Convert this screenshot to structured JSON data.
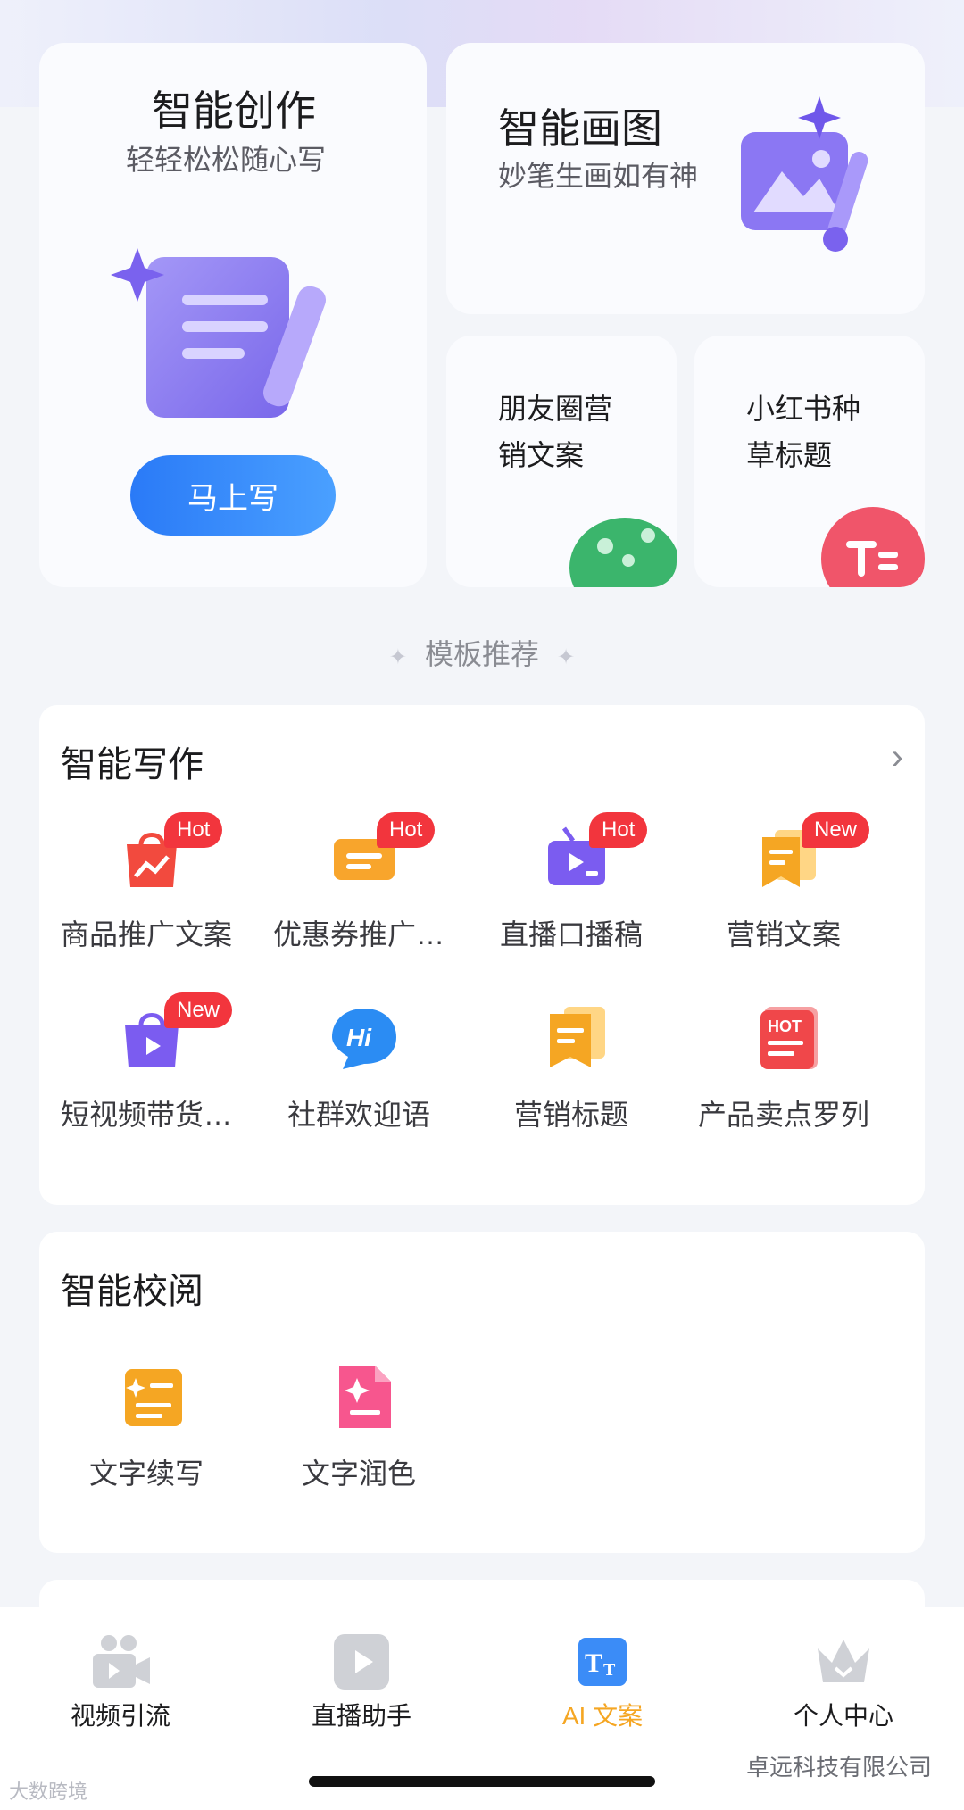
{
  "hero": {
    "create": {
      "title": "智能创作",
      "subtitle": "轻轻松松随心写",
      "button": "马上写"
    },
    "draw": {
      "title": "智能画图",
      "subtitle": "妙笔生画如有神"
    },
    "moments": {
      "line1": "朋友圈营",
      "line2": "销文案"
    },
    "xhs": {
      "line1": "小红书种",
      "line2": "草标题"
    }
  },
  "divider": {
    "label": "模板推荐"
  },
  "writing": {
    "title": "智能写作",
    "items": [
      {
        "label": "商品推广文案",
        "badge": "Hot",
        "icon": "shopping-bag-trend-icon",
        "color": "#f24a3e"
      },
      {
        "label": "优惠券推广…",
        "badge": "Hot",
        "icon": "coupon-icon",
        "color": "#f8a52c"
      },
      {
        "label": "直播口播稿",
        "badge": "Hot",
        "icon": "live-tv-icon",
        "color": "#7b5cf0"
      },
      {
        "label": "营销文案",
        "badge": "New",
        "icon": "bookmark-doc-icon",
        "color": "#f5a623"
      },
      {
        "label": "短视频带货…",
        "badge": "New",
        "icon": "video-bag-icon",
        "color": "#7b5cf0"
      },
      {
        "label": "社群欢迎语",
        "badge": "",
        "icon": "hi-chat-icon",
        "color": "#2b8cf3"
      },
      {
        "label": "营销标题",
        "badge": "",
        "icon": "bookmark-title-icon",
        "color": "#f5a623"
      },
      {
        "label": "产品卖点罗列",
        "badge": "",
        "icon": "hot-list-icon",
        "color": "#f0474a"
      }
    ]
  },
  "proof": {
    "title": "智能校阅",
    "items": [
      {
        "label": "文字续写",
        "icon": "scroll-continue-icon",
        "color": "#f5a623"
      },
      {
        "label": "文字润色",
        "icon": "doc-polish-icon",
        "color": "#f7568e"
      }
    ]
  },
  "tabs": [
    {
      "label": "视频引流",
      "icon": "video-camera-icon"
    },
    {
      "label": "直播助手",
      "icon": "play-icon"
    },
    {
      "label": "AI 文案",
      "icon": "text-tt-icon",
      "active": true
    },
    {
      "label": "个人中心",
      "icon": "crown-icon"
    }
  ],
  "watermarks": {
    "left": "大数跨境",
    "right": "卓远科技有限公司"
  },
  "colors": {
    "accent": "#2a7af7",
    "active_tab": "#f5a623",
    "badge": "#f2353d"
  }
}
